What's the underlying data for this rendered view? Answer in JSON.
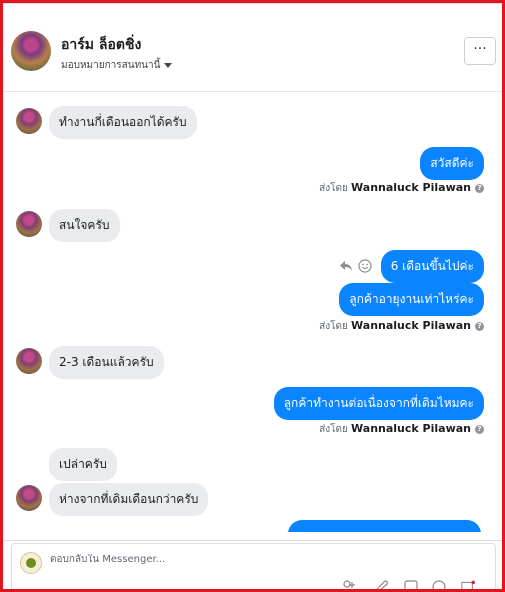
{
  "header": {
    "contact_name": "อาร์ม ล็อตชิ่ง",
    "assign_label": "มอบหมายการสนทนานี้",
    "more_label": "···"
  },
  "messages": [
    {
      "side": "in",
      "text": "ทำงานกี่เดือนออกได้ครับ",
      "avatar": true
    },
    {
      "side": "out",
      "text": "สวัสดีค่ะ"
    },
    {
      "side": "sentby",
      "prefix": "ส่งโดย",
      "name": "Wannaluck Pilawan"
    },
    {
      "side": "in",
      "text": "สนใจครับ",
      "avatar": true
    },
    {
      "side": "out",
      "text": "6 เดือนขึ้นไปค่ะ"
    },
    {
      "side": "out",
      "text": "ลูกค้าอายุงานเท่าไหร่คะ"
    },
    {
      "side": "sentby",
      "prefix": "ส่งโดย",
      "name": "Wannaluck Pilawan"
    },
    {
      "side": "in",
      "text": "2-3 เดือนแล้วครับ",
      "avatar": true
    },
    {
      "side": "out",
      "text": "ลูกค้าทำงานต่อเนื่องจากที่เดิมไหมคะ"
    },
    {
      "side": "sentby",
      "prefix": "ส่งโดย",
      "name": "Wannaluck Pilawan"
    },
    {
      "side": "in",
      "text": "เปล่าครับ",
      "avatar": false
    },
    {
      "side": "in",
      "text": "ห่างจากที่เดิมเดือนกว่าครับ",
      "avatar": true
    }
  ],
  "composer": {
    "placeholder": "ตอบกลับใน Messenger..."
  },
  "colors": {
    "outgoing_bubble": "#0a84ff",
    "incoming_bubble": "#e9ebee",
    "frame": "#e2141f"
  },
  "icons": [
    "reply-icon",
    "smiley-icon",
    "more-icon",
    "caret-down-icon",
    "info-icon",
    "add-person-icon",
    "attachment-icon",
    "sticker-icon",
    "emoji-icon",
    "gif-icon"
  ]
}
